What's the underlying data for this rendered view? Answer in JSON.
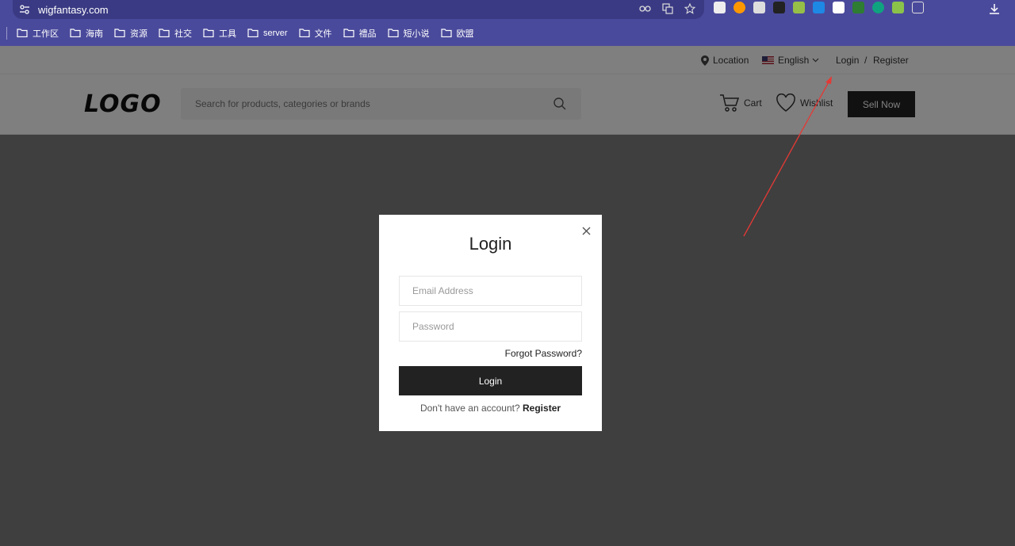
{
  "browser": {
    "url": "wigfantasy.com"
  },
  "bookmarks": [
    {
      "label": "工作区"
    },
    {
      "label": "海南"
    },
    {
      "label": "资源"
    },
    {
      "label": "社交"
    },
    {
      "label": "工具"
    },
    {
      "label": "server"
    },
    {
      "label": "文件"
    },
    {
      "label": "禮品"
    },
    {
      "label": "短小说"
    },
    {
      "label": "欧盟"
    }
  ],
  "topbar": {
    "location": "Location",
    "language": "English",
    "login": "Login",
    "separator": "/",
    "register": "Register"
  },
  "header": {
    "logo": "LOGO",
    "search_placeholder": "Search for products, categories or brands",
    "cart": "Cart",
    "wishlist": "Wishlist",
    "sell_now": "Sell Now"
  },
  "modal": {
    "title": "Login",
    "email_placeholder": "Email Address",
    "password_placeholder": "Password",
    "forgot": "Forgot Password?",
    "login_button": "Login",
    "no_account": "Don't have an account?",
    "register": "Register"
  },
  "colors": {
    "browser_bar": "#4a4a9c",
    "annotation_arrow": "#e53935"
  }
}
